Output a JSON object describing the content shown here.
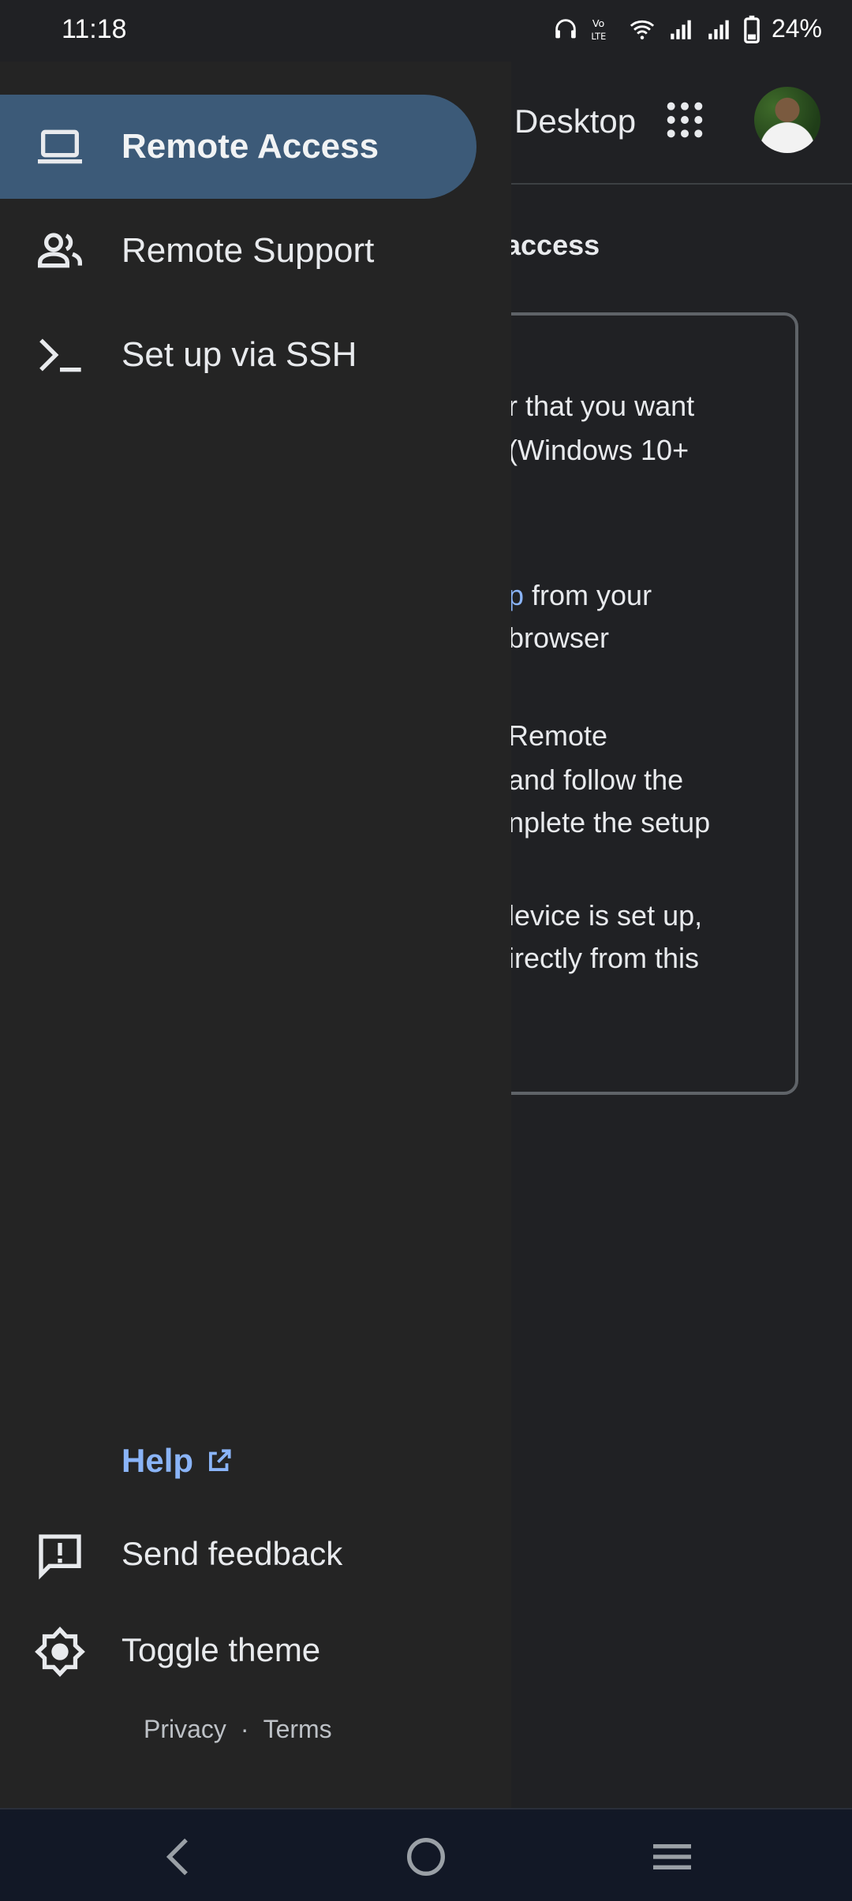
{
  "status_bar": {
    "time": "11:18",
    "battery": "24%",
    "icons": [
      "headphones-icon",
      "volte-icon",
      "wifi-icon",
      "signal-icon",
      "signal-icon",
      "battery-icon"
    ]
  },
  "app": {
    "title_partial": "Desktop",
    "section_title_partial": "access",
    "card_lines": [
      "r that you want",
      " (Windows 10+",
      "p",
      " from your",
      "browser",
      "Remote",
      "and follow the",
      "nplete the setup",
      "levice is set up,",
      "irectly from this"
    ]
  },
  "drawer": {
    "items": [
      {
        "label": "Remote Access",
        "icon": "laptop-icon",
        "active": true
      },
      {
        "label": "Remote Support",
        "icon": "people-icon",
        "active": false
      },
      {
        "label": "Set up via SSH",
        "icon": "terminal-icon",
        "active": false
      }
    ],
    "help_label": "Help",
    "feedback_label": "Send feedback",
    "theme_label": "Toggle theme",
    "privacy_label": "Privacy",
    "separator": "·",
    "terms_label": "Terms"
  },
  "colors": {
    "accent": "#8ab4f8",
    "active_item_bg": "#3c5a78",
    "drawer_bg": "#242424",
    "app_bg": "#202124"
  }
}
